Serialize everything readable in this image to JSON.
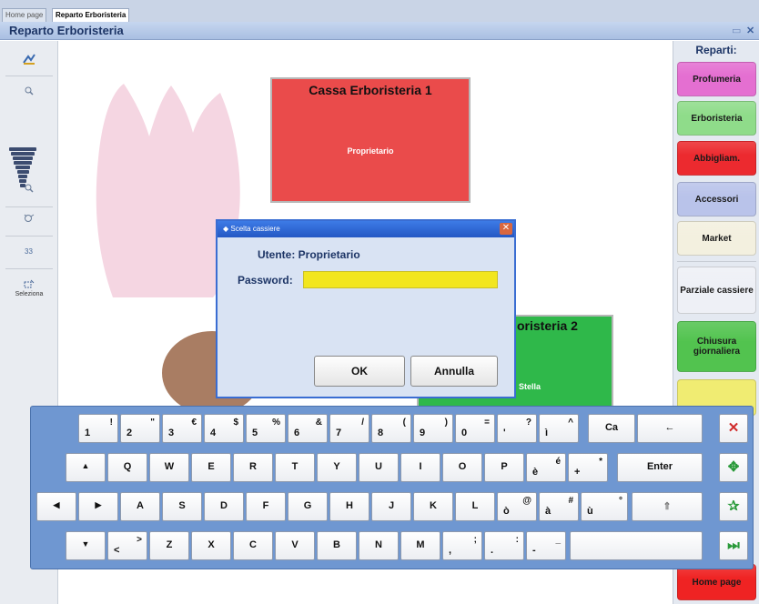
{
  "tabs": [
    {
      "label": "Home page"
    },
    {
      "label": "Reparto Erboristeria"
    }
  ],
  "window": {
    "title": "Reparto Erboristeria"
  },
  "left_toolbar": {
    "select_label": "Seleziona"
  },
  "canvas": {
    "box1": {
      "title": "Cassa Erboristeria 1",
      "subtitle": "Proprietario"
    },
    "box2": {
      "title": "oristeria 2",
      "subtitle": "Stella"
    }
  },
  "right_panel": {
    "title": "Reparti:",
    "buttons": [
      {
        "label": "Profumeria",
        "color": "#e46fd1"
      },
      {
        "label": "Erboristeria",
        "color": "#8fdc8a"
      },
      {
        "label": "Abbigliam.",
        "color": "#ec2a2f"
      },
      {
        "label": "Accessori",
        "color": "#b9c3ea"
      },
      {
        "label": "Market",
        "color": "#f3f0df"
      },
      {
        "label": "Parziale cassiere",
        "color": "#eef0f6"
      },
      {
        "label": "Chiusura giornaliera",
        "color": "#52c34f"
      },
      {
        "label": "Home page",
        "color": "#ef2323"
      }
    ]
  },
  "dialog": {
    "title": "Scelta cassiere",
    "user_text": "Utente: Proprietario",
    "password_label": "Password:",
    "password_value": "",
    "ok_label": "OK",
    "cancel_label": "Annulla"
  },
  "keyboard": {
    "row1": [
      {
        "top": "!",
        "bottom": "1"
      },
      {
        "top": "\"",
        "bottom": "2"
      },
      {
        "top": "€",
        "bottom": "3"
      },
      {
        "top": "$",
        "bottom": "4"
      },
      {
        "top": "%",
        "bottom": "5"
      },
      {
        "top": "&",
        "bottom": "6"
      },
      {
        "top": "/",
        "bottom": "7"
      },
      {
        "top": "(",
        "bottom": "8"
      },
      {
        "top": ")",
        "bottom": "9"
      },
      {
        "top": "=",
        "bottom": "0"
      },
      {
        "top": "?",
        "bottom": "'"
      },
      {
        "top": "^",
        "bottom": "ì"
      }
    ],
    "row1_ca": "Ca",
    "row1_backspace": "←",
    "row2_shift": "▲",
    "row2": [
      "Q",
      "W",
      "E",
      "R",
      "T",
      "Y",
      "U",
      "I",
      "O",
      "P"
    ],
    "row2_acc1": {
      "top": "é",
      "bottom": "è"
    },
    "row2_acc2": {
      "top": "*",
      "bottom": "+"
    },
    "row2_enter": "Enter",
    "row3_left": "◀",
    "row3_right": "▶",
    "row3": [
      "A",
      "S",
      "D",
      "F",
      "G",
      "H",
      "J",
      "K",
      "L"
    ],
    "row3_acc1": {
      "top": "@",
      "bottom": "ò"
    },
    "row3_acc2": {
      "top": "#",
      "bottom": "à"
    },
    "row3_acc3": {
      "top": "°",
      "bottom": "ù"
    },
    "row3_caps": "⇑",
    "row4_down": "▼",
    "row4_angle": {
      "top": ">",
      "bottom": "<"
    },
    "row4": [
      "Z",
      "X",
      "C",
      "V",
      "B",
      "N",
      "M"
    ],
    "row4_punct": [
      {
        "top": ";",
        "bottom": ","
      },
      {
        "top": ":",
        "bottom": "."
      },
      {
        "top": "_",
        "bottom": "-"
      }
    ],
    "side": {
      "close": "✕",
      "move": "✥",
      "pin": "✰",
      "end": "⏭"
    }
  }
}
